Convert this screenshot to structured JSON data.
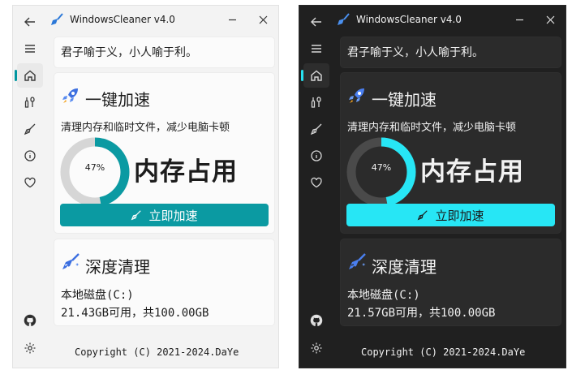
{
  "light": {
    "title": "WindowsCleaner v4.0",
    "motto": "君子喻于义，小人喻于利。",
    "boost": {
      "title": "一键加速",
      "description": "清理内存和临时文件，减少电脑卡顿",
      "memory_percent": 47,
      "memory_percent_label": "47%",
      "memory_label": "内存占用",
      "button_label": "立即加速"
    },
    "deep_clean": {
      "title": "深度清理",
      "disk_name": "本地磁盘(C:)",
      "disk_info": "21.43GB可用，共100.00GB"
    },
    "copyright": "Copyright (C) 2021-2024.DaYe"
  },
  "dark": {
    "title": "WindowsCleaner v4.0",
    "motto": "君子喻于义，小人喻于利。",
    "boost": {
      "title": "一键加速",
      "description": "清理内存和临时文件，减少电脑卡顿",
      "memory_percent": 47,
      "memory_percent_label": "47%",
      "memory_label": "内存占用",
      "button_label": "立即加速"
    },
    "deep_clean": {
      "title": "深度清理",
      "disk_name": "本地磁盘(C:)",
      "disk_info": "21.57GB可用，共100.00GB"
    },
    "copyright": "Copyright (C) 2021-2024.DaYe"
  },
  "nav_icons": [
    "back-arrow-icon",
    "hamburger-menu-icon",
    "home-icon",
    "tools-icon",
    "broom-icon",
    "info-icon",
    "heart-icon",
    "github-icon",
    "gear-icon"
  ],
  "colors": {
    "light_accent": "#0b9aa2",
    "dark_accent": "#27e6f5",
    "ring_track_light": "#d6d6d6",
    "ring_track_dark": "#4a4a4a"
  }
}
